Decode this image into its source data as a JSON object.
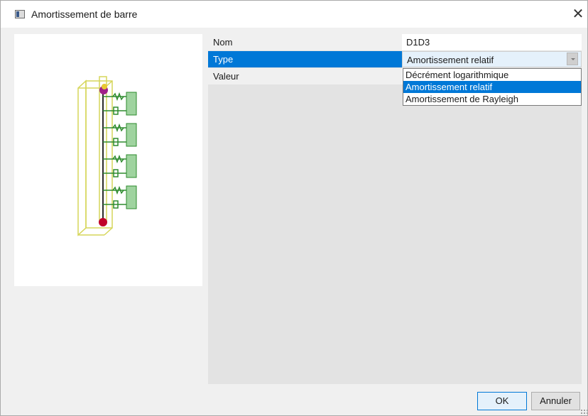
{
  "window": {
    "title": "Amortissement de barre",
    "close_glyph": "✕"
  },
  "properties": [
    {
      "label": "Nom",
      "value": "D1D3"
    },
    {
      "label": "Type",
      "value": "Amortissement relatif"
    },
    {
      "label": "Valeur",
      "value": ""
    }
  ],
  "type_dropdown": {
    "options": [
      "Décrément logarithmique",
      "Amortissement relatif",
      "Amortissement de Rayleigh"
    ],
    "selected": "Amortissement relatif"
  },
  "buttons": {
    "ok": "OK",
    "cancel": "Annuler"
  },
  "icons": {
    "app": "window-app-icon",
    "close": "close-icon",
    "dropdown": "chevron-down-icon",
    "resize": "resize-grip-icon"
  },
  "colors": {
    "selection": "#0078d7",
    "model_frame": "#d6d65a",
    "model_spring": "#2e8b2e",
    "model_block": "#9fd39f",
    "node_red": "#c0002a",
    "node_magenta": "#a0208a"
  }
}
